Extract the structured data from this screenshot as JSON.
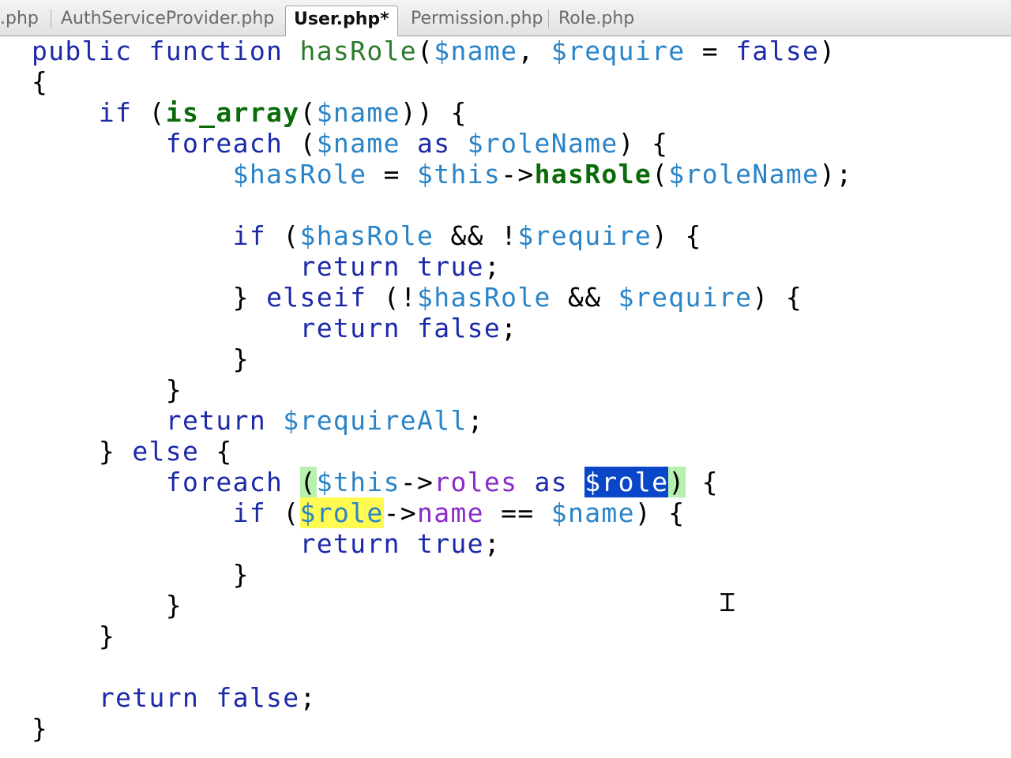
{
  "tabs": [
    {
      "label": ".php",
      "active": false
    },
    {
      "label": "AuthServiceProvider.php",
      "active": false
    },
    {
      "label": "User.php*",
      "active": true
    },
    {
      "label": "Permission.php",
      "active": false
    },
    {
      "label": "Role.php",
      "active": false
    }
  ],
  "code": {
    "l1_kw1": "public",
    "l1_kw2": "function",
    "l1_fn": "hasRole",
    "l1_p1": "(",
    "l1_v1": "$name",
    "l1_p2": ", ",
    "l1_v2": "$require",
    "l1_p3": " = ",
    "l1_kw3": "false",
    "l1_p4": ")",
    "l2_brace": "{",
    "l3_kw": "if",
    "l3_p1": " (",
    "l3_fn": "is_array",
    "l3_p2": "(",
    "l3_v": "$name",
    "l3_p3": ")) {",
    "l4_kw": "foreach",
    "l4_p1": " (",
    "l4_v1": "$name",
    "l4_kw2": " as ",
    "l4_v2": "$roleName",
    "l4_p2": ") {",
    "l5_v1": "$hasRole",
    "l5_p1": " = ",
    "l5_v2": "$this",
    "l5_p2": "->",
    "l5_fn": "hasRole",
    "l5_p3": "(",
    "l5_v3": "$roleName",
    "l5_p4": ");",
    "l7_kw": "if",
    "l7_p1": " (",
    "l7_v1": "$hasRole",
    "l7_p2": " && !",
    "l7_v2": "$require",
    "l7_p3": ") {",
    "l8_kw": "return",
    "l8_kw2": " true",
    "l8_p": ";",
    "l9_p1": "} ",
    "l9_kw": "elseif",
    "l9_p2": " (!",
    "l9_v1": "$hasRole",
    "l9_p3": " && ",
    "l9_v2": "$require",
    "l9_p4": ") {",
    "l10_kw": "return",
    "l10_kw2": " false",
    "l10_p": ";",
    "l11_brace": "}",
    "l12_brace": "}",
    "l13_kw": "return",
    "l13_v": " $requireAll",
    "l13_p": ";",
    "l14_p1": "} ",
    "l14_kw": "else",
    "l14_p2": " {",
    "l15_kw": "foreach",
    "l15_p1": " ",
    "l15_hl1": "(",
    "l15_v1": "$this",
    "l15_p2": "->",
    "l15_prop": "roles",
    "l15_kw2": " as ",
    "l15_sel": "$role",
    "l15_hl2": ")",
    "l15_p3": " {",
    "l16_kw": "if",
    "l16_p1": " (",
    "l16_v1": "$role",
    "l16_p2": "->",
    "l16_prop": "name",
    "l16_p3": " == ",
    "l16_v2": "$name",
    "l16_p4": ") {",
    "l17_kw": "return",
    "l17_kw2": " true",
    "l17_p": ";",
    "l18_brace": "}",
    "l19_brace": "}",
    "l20_brace": "}",
    "l22_kw": "return",
    "l22_kw2": " false",
    "l22_p": ";",
    "l23_brace": "}"
  },
  "colors": {
    "keyword": "#1c2aa8",
    "variable": "#2a84c8",
    "function": "#2c7a2c",
    "property": "#8a2bc8",
    "selection": "#0a46c8",
    "match_highlight": "#fffb50",
    "bracket_highlight": "#b8f0b0"
  },
  "icons": {
    "cursor": "text-cursor-icon"
  }
}
